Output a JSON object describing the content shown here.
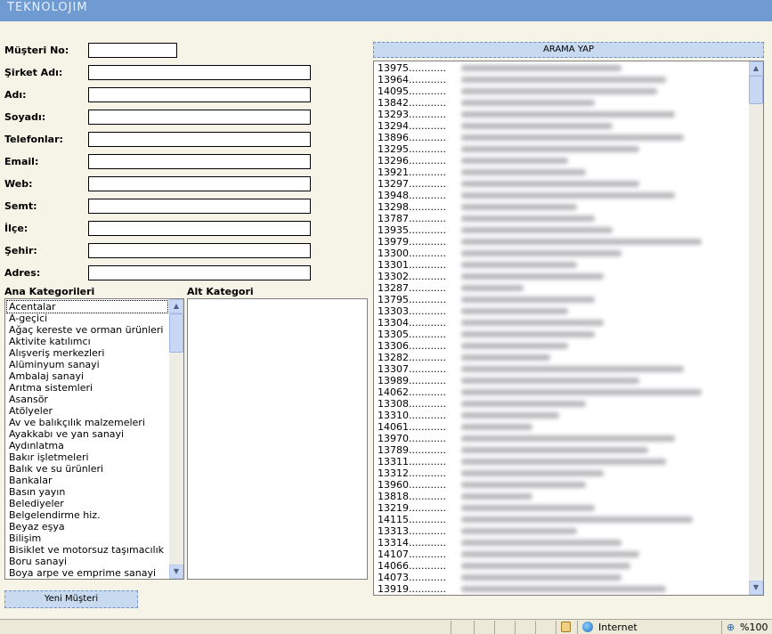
{
  "header": {
    "logo": "TEKNOLOJIM"
  },
  "form": {
    "fields": [
      {
        "label": "Müşteri No:",
        "value": ""
      },
      {
        "label": "Şirket Adı:",
        "value": ""
      },
      {
        "label": "Adı:",
        "value": ""
      },
      {
        "label": "Soyadı:",
        "value": ""
      },
      {
        "label": "Telefonlar:",
        "value": ""
      },
      {
        "label": "Email:",
        "value": ""
      },
      {
        "label": "Web:",
        "value": ""
      },
      {
        "label": "Semt:",
        "value": ""
      },
      {
        "label": "İlçe:",
        "value": ""
      },
      {
        "label": "Şehir:",
        "value": ""
      },
      {
        "label": "Adres:",
        "value": ""
      }
    ]
  },
  "categories": {
    "main_label": "Ana Kategorileri",
    "sub_label": "Alt Kategori",
    "main_items": [
      "Acentalar",
      "A-geçici",
      "Ağaç kereste ve orman ürünleri",
      "Aktivite katılımcı",
      "Alışveriş merkezleri",
      "Alüminyum sanayi",
      "Ambalaj sanayi",
      "Arıtma sistemleri",
      "Asansör",
      "Atölyeler",
      "Av ve balıkçılık malzemeleri",
      "Ayakkabı ve yan sanayi",
      "Aydınlatma",
      "Bakır işletmeleri",
      "Balık ve su ürünleri",
      "Bankalar",
      "Basın yayın",
      "Belediyeler",
      "Belgelendirme hiz.",
      "Beyaz eşya",
      "Bilişim",
      "Bisiklet ve motorsuz taşımacılık",
      "Boru sanayi",
      "Boya arpe ve emprime sanayi"
    ],
    "selected_index": 0,
    "sub_items": []
  },
  "buttons": {
    "search": "ARAMA YAP",
    "new_customer": "Yeni Müşteri"
  },
  "results": {
    "items": [
      "13975............",
      "13964............",
      "14095............",
      "13842............",
      "13293............",
      "13294............",
      "13896............",
      "13295............",
      "13296............",
      "13921............",
      "13297............",
      "13948............",
      "13298............",
      "13787............",
      "13935............",
      "13979............",
      "13300............",
      "13301............",
      "13302............",
      "13287............",
      "13795............",
      "13303............",
      "13304............",
      "13305............",
      "13306............",
      "13282............",
      "13307............",
      "13989............",
      "14062............",
      "13308............",
      "13310............",
      "14061............",
      "13970............",
      "13789............",
      "13311............",
      "13312............",
      "13960............",
      "13818............",
      "13219............",
      "14115............",
      "13313............",
      "13314............",
      "14107............",
      "14066............",
      "14073............",
      "13919............"
    ]
  },
  "statusbar": {
    "zone": "Internet",
    "zoom": "%100"
  }
}
